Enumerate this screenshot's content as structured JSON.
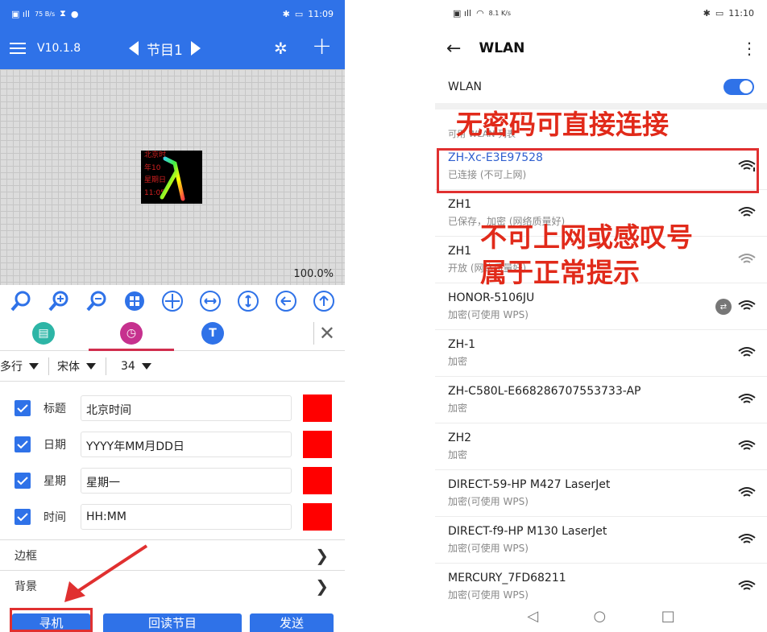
{
  "left": {
    "status": {
      "left_text": "75 B/s",
      "time": "11:09"
    },
    "appbar": {
      "version": "V10.1.8",
      "program": "节目1"
    },
    "canvas": {
      "zoom": "100.0%",
      "preview_lines": [
        "北京时",
        "年10",
        "星期日",
        "11:05"
      ]
    },
    "font_row": {
      "mode": "多行",
      "font": "宋体",
      "size": "34"
    },
    "fields": [
      {
        "label": "标题",
        "value": "北京时间"
      },
      {
        "label": "日期",
        "value": "YYYY年MM月DD日"
      },
      {
        "label": "星期",
        "value": "星期一"
      },
      {
        "label": "时间",
        "value": "HH:MM"
      }
    ],
    "nav_rows": [
      "边框",
      "背景"
    ],
    "buttons": {
      "search": "寻机",
      "readback": "回读节目",
      "send": "发送"
    },
    "colors": {
      "accent": "#2f72e8",
      "field_color": "#ff0000"
    }
  },
  "right": {
    "status": {
      "left_text": "8.1 K/s",
      "time": "11:10"
    },
    "title": "WLAN",
    "wlan_label": "WLAN",
    "section_header": "可用 WLAN 列表",
    "networks": [
      {
        "name": "ZH-Xc-E3E97528",
        "status": "已连接 (不可上网)"
      },
      {
        "name": "ZH1",
        "status": "已保存，加密 (网络质量好)"
      },
      {
        "name": "ZH1",
        "status": "开放 (网络质量好)"
      },
      {
        "name": "HONOR-5106JU",
        "status": "加密(可使用 WPS)"
      },
      {
        "name": "ZH-1",
        "status": "加密"
      },
      {
        "name": "ZH-C580L-E668286707553733-AP",
        "status": "加密"
      },
      {
        "name": "ZH2",
        "status": "加密"
      },
      {
        "name": "DIRECT-59-HP M427 LaserJet",
        "status": "加密(可使用 WPS)"
      },
      {
        "name": "DIRECT-f9-HP M130 LaserJet",
        "status": "加密(可使用 WPS)"
      },
      {
        "name": "MERCURY_7FD68211",
        "status": "加密(可使用 WPS)"
      }
    ],
    "annotations": {
      "no_password": "无密码可直接连接",
      "no_internet_1": "不可上网或感叹号",
      "no_internet_2": "属于正常提示"
    }
  }
}
